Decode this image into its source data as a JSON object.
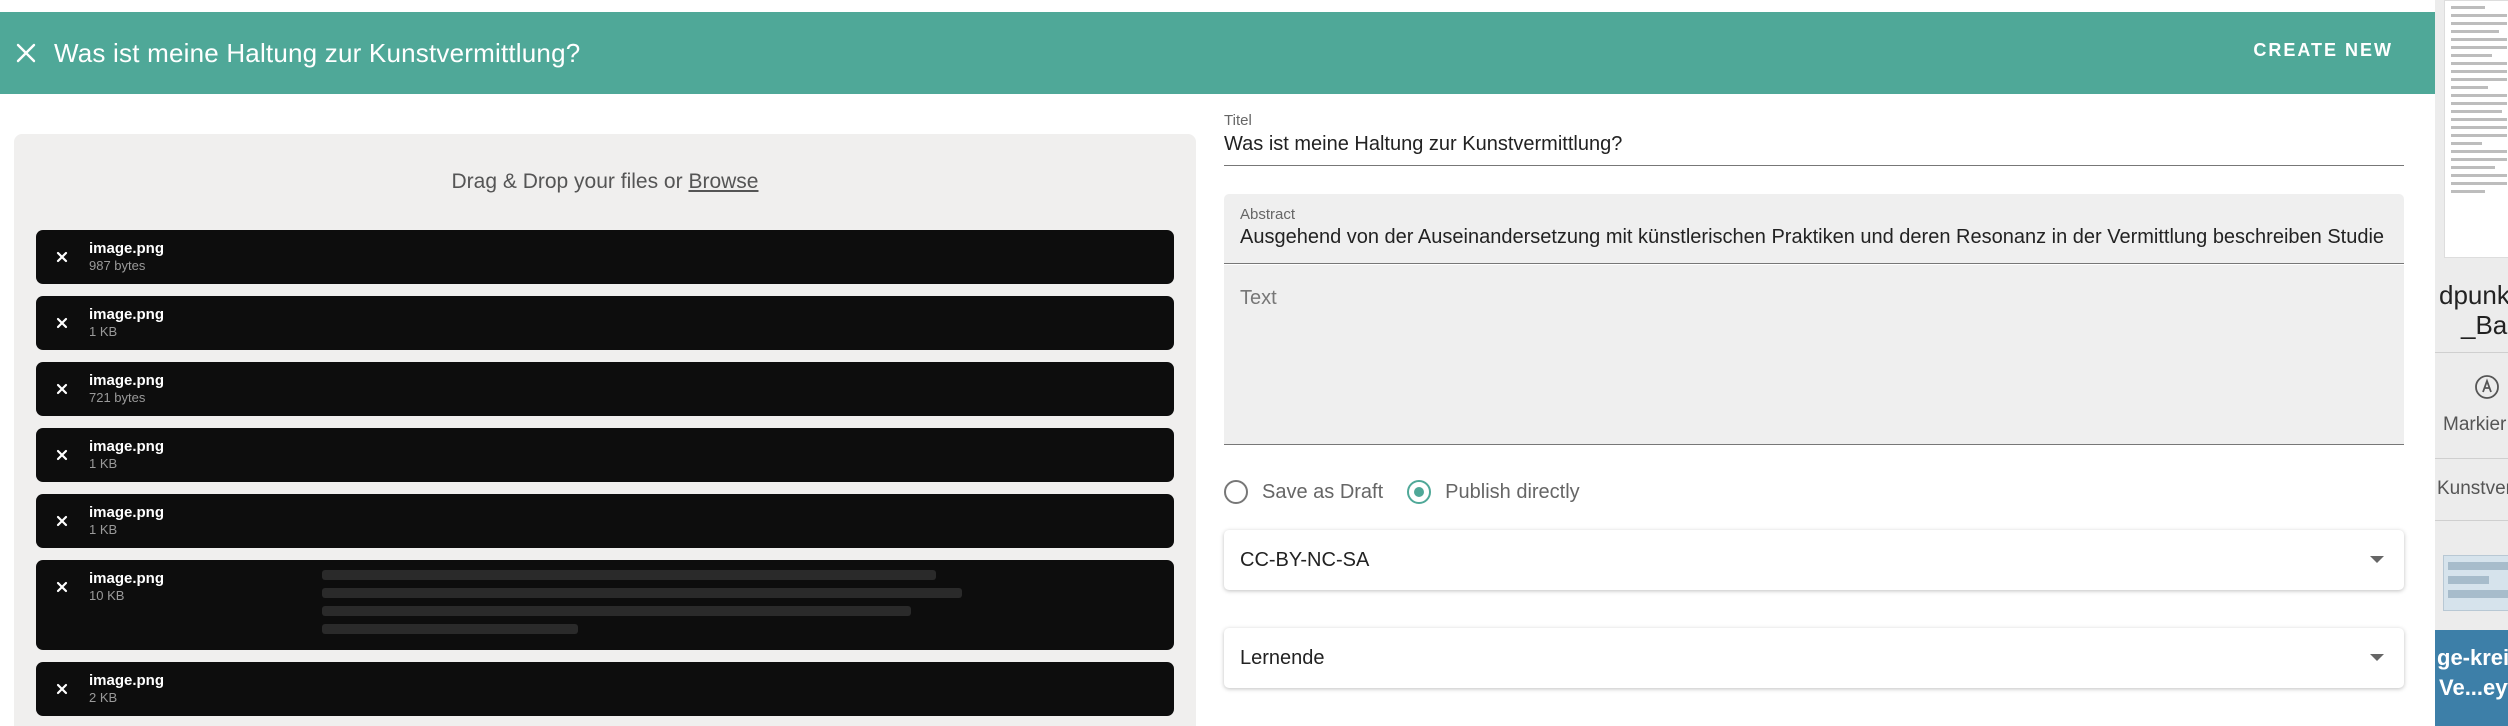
{
  "header": {
    "title": "Was ist meine Haltung zur Kunstvermittlung?",
    "create_label": "CREATE NEW",
    "color": "#4fa898"
  },
  "upload": {
    "drop_text": "Drag & Drop your files or",
    "browse_label": "Browse",
    "files": [
      {
        "name": "image.png",
        "size": "987 bytes"
      },
      {
        "name": "image.png",
        "size": "1 KB"
      },
      {
        "name": "image.png",
        "size": "721 bytes"
      },
      {
        "name": "image.png",
        "size": "1 KB"
      },
      {
        "name": "image.png",
        "size": "1 KB"
      },
      {
        "name": "image.png",
        "size": "10 KB"
      },
      {
        "name": "image.png",
        "size": "2 KB"
      }
    ]
  },
  "form": {
    "title_label": "Titel",
    "title_value": "Was ist meine Haltung zur Kunstvermittlung?",
    "abstract_label": "Abstract",
    "abstract_value": "Ausgehend von der Auseinandersetzung mit künstlerischen Praktiken und deren Resonanz in der Vermittlung beschreiben Studie",
    "text_placeholder": "Text",
    "radio_draft": "Save as Draft",
    "radio_publish": "Publish directly",
    "selected_radio": "publish",
    "license_value": "CC-BY-NC-SA",
    "audience_value": "Lernende"
  },
  "sidebar": {
    "line1": "dpunk",
    "line2": "_Bas",
    "mark_label": "Markier",
    "item_label": "Kunstver",
    "bottom_line1": "ge-kreis",
    "bottom_line2": "Ve...eyw"
  }
}
